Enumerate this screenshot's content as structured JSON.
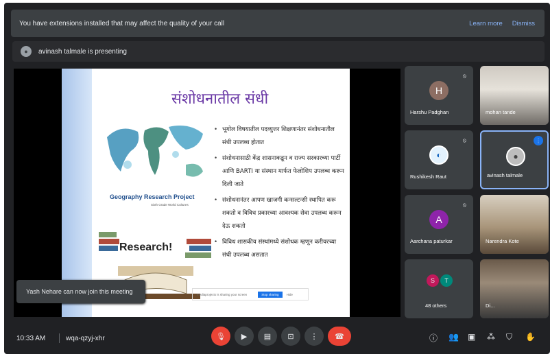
{
  "banner": {
    "message": "You have extensions installed that may affect the quality of your call",
    "learn_more": "Learn more",
    "dismiss": "Dismiss"
  },
  "presenting": {
    "text": "avinash talmale is presenting"
  },
  "slide": {
    "title": "संशोधनातील संधी",
    "project_title": "Geography Research Project",
    "project_sub": "Sixth Grade World Cultures",
    "research_label": "Research!",
    "bullets": [
      "भूगोल विषयातील पदव्युत्तर शिक्षणानंतर संशोधनातील संधी उपलब्ध होतात",
      "संशोधनासाठी केंद्र शासनाकडून व राज्य सरकारच्या पार्टी आणि BARTI या संस्थान मार्फत फेलोशिप उपलब्ध करून दिली जाते",
      "संशोधनानंतर आपण खाजगी कन्सल्टन्सी स्थापित करू शकतो व विविध प्रकारच्या आवश्यक सेवा उपलब्ध करून देऊ शकतो",
      "विविध शासकीय संस्थांमध्ये संशोधक म्हणून करीयरच्या संधी उपलब्ध असतात"
    ],
    "ad_text": "mediaprojects is sharing your screen",
    "ad_button": "Stop sharing",
    "ad_hide": "Hide"
  },
  "toast": {
    "text": "Yash Nehare can now join this meeting"
  },
  "participants": [
    {
      "name": "Harshu Padghan",
      "initial": "H",
      "color": "#8d6e63"
    },
    {
      "name": "mohan tande"
    },
    {
      "name": "Rushikesh Raut"
    },
    {
      "name": "avinash talmale"
    },
    {
      "name": "Aarchana paturkar",
      "initial": "A",
      "color": "#8e24aa"
    },
    {
      "name": "Narendra Kote"
    },
    {
      "name": "48 others",
      "initial1": "S",
      "initial2": "T",
      "color1": "#c2185b",
      "color2": "#00897b"
    },
    {
      "name": "Di..."
    }
  ],
  "controls": {
    "time": "10:33 AM",
    "code": "wqa-qzyj-xhr"
  }
}
